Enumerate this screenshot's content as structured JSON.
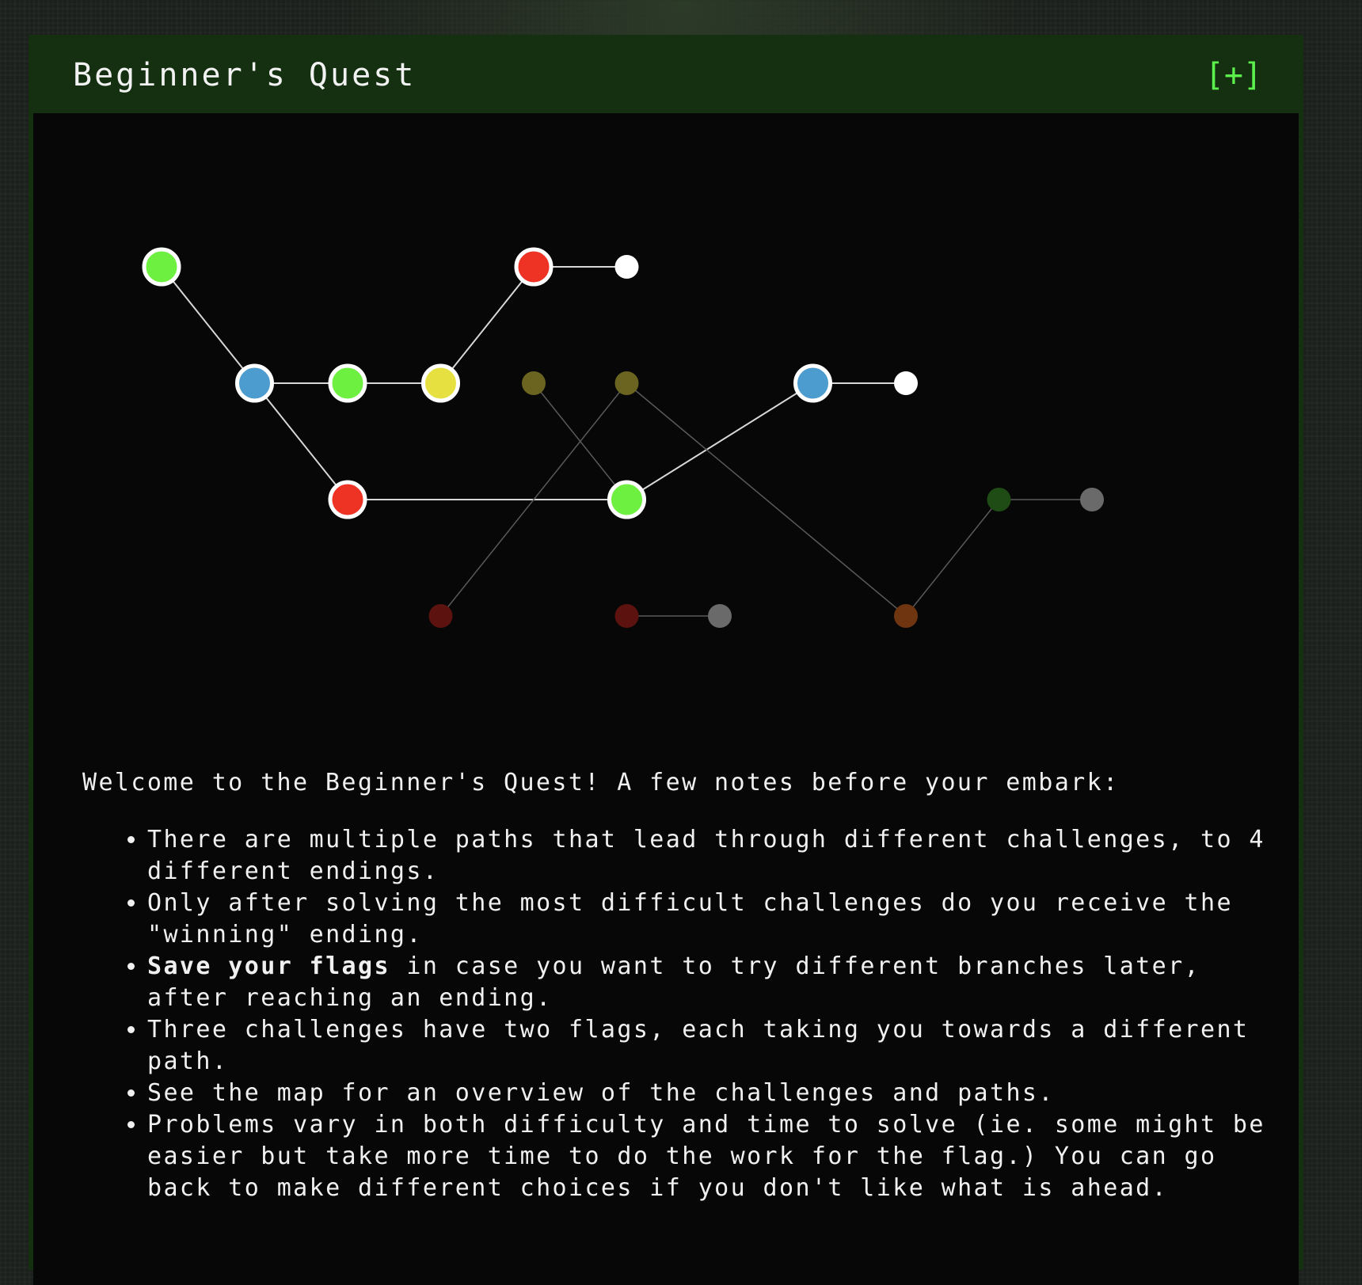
{
  "panel": {
    "title": "Beginner's Quest",
    "expand_label": "[+]"
  },
  "map": {
    "nodes": [
      {
        "id": "n1",
        "col": 0,
        "row": 0,
        "color": "#6ef040",
        "state": "active"
      },
      {
        "id": "n2",
        "col": 1,
        "row": 1,
        "color": "#4d9ccf",
        "state": "active"
      },
      {
        "id": "n3",
        "col": 2,
        "row": 1,
        "color": "#6ef040",
        "state": "active"
      },
      {
        "id": "n4",
        "col": 3,
        "row": 1,
        "color": "#e6e140",
        "state": "active"
      },
      {
        "id": "n5",
        "col": 4,
        "row": 0,
        "color": "#ee3224",
        "state": "active"
      },
      {
        "id": "n6",
        "col": 5,
        "row": 0,
        "color": "#ffffff",
        "state": "end"
      },
      {
        "id": "n7",
        "col": 2,
        "row": 2,
        "color": "#ee3224",
        "state": "active"
      },
      {
        "id": "n8",
        "col": 5,
        "row": 2,
        "color": "#6ef040",
        "state": "active"
      },
      {
        "id": "n9",
        "col": 7,
        "row": 1,
        "color": "#4d9ccf",
        "state": "active"
      },
      {
        "id": "n10",
        "col": 8,
        "row": 1,
        "color": "#ffffff",
        "state": "end"
      },
      {
        "id": "n11",
        "col": 4,
        "row": 1,
        "color": "#6b6420",
        "state": "locked"
      },
      {
        "id": "n12",
        "col": 5,
        "row": 1,
        "color": "#6b6420",
        "state": "locked"
      },
      {
        "id": "n13",
        "col": 3,
        "row": 3,
        "color": "#5c120e",
        "state": "locked"
      },
      {
        "id": "n14",
        "col": 5,
        "row": 3,
        "color": "#5c120e",
        "state": "locked"
      },
      {
        "id": "n15",
        "col": 6,
        "row": 3,
        "color": "#6a6a6a",
        "state": "locked-end"
      },
      {
        "id": "n16",
        "col": 8,
        "row": 3,
        "color": "#6e3510",
        "state": "locked"
      },
      {
        "id": "n17",
        "col": 9,
        "row": 2,
        "color": "#1e4c14",
        "state": "locked"
      },
      {
        "id": "n18",
        "col": 10,
        "row": 2,
        "color": "#6a6a6a",
        "state": "locked-end"
      }
    ],
    "edges": [
      {
        "from": "n1",
        "to": "n2",
        "state": "active"
      },
      {
        "from": "n2",
        "to": "n3",
        "state": "active"
      },
      {
        "from": "n3",
        "to": "n4",
        "state": "active"
      },
      {
        "from": "n4",
        "to": "n5",
        "state": "active"
      },
      {
        "from": "n5",
        "to": "n6",
        "state": "active"
      },
      {
        "from": "n2",
        "to": "n7",
        "state": "active"
      },
      {
        "from": "n7",
        "to": "n8",
        "state": "active"
      },
      {
        "from": "n8",
        "to": "n9",
        "state": "active"
      },
      {
        "from": "n9",
        "to": "n10",
        "state": "active"
      },
      {
        "from": "n11",
        "to": "n8",
        "state": "locked"
      },
      {
        "from": "n12",
        "to": "n13",
        "state": "locked"
      },
      {
        "from": "n12",
        "to": "n16",
        "state": "locked"
      },
      {
        "from": "n16",
        "to": "n17",
        "state": "locked"
      },
      {
        "from": "n17",
        "to": "n18",
        "state": "locked"
      },
      {
        "from": "n14",
        "to": "n15",
        "state": "locked"
      }
    ]
  },
  "intro": {
    "welcome": "Welcome to the Beginner's Quest! A few notes before your embark:",
    "notes": [
      {
        "text": "There are multiple paths that lead through different challenges, to 4 different endings."
      },
      {
        "text": "Only after solving the most difficult challenges do you receive the \"winning\" ending."
      },
      {
        "bold": "Save your flags",
        "text": " in case you want to try different branches later, after reaching an ending."
      },
      {
        "text": "Three challenges have two flags, each taking you towards a different path."
      },
      {
        "text": "See the map for an overview of the challenges and paths."
      },
      {
        "text": "Problems vary in both difficulty and time to solve (ie. some might be easier but take more time to do the work for the flag.) You can go back to make different choices if you don't like what is ahead."
      }
    ]
  }
}
